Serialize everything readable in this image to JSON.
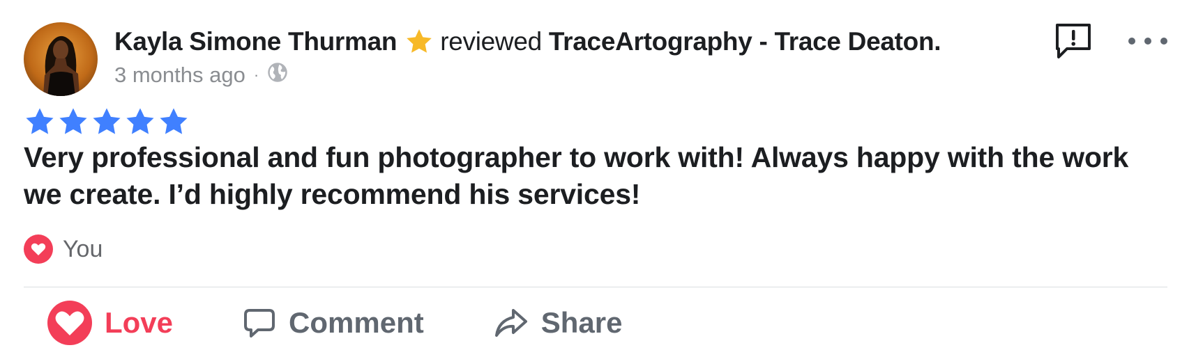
{
  "post": {
    "author_name": "Kayla Simone Thurman",
    "action_text": "reviewed",
    "page_name": "TraceArtography - Trace Deaton.",
    "timestamp": "3 months ago",
    "separator": "·",
    "privacy_icon": "globe-icon",
    "badge_icon": "star-icon",
    "rating": 5,
    "rating_max": 5,
    "review_text": "Very professional and fun photographer to work with! Always happy with the work we create. I’d highly recommend his services!"
  },
  "reactions": {
    "icon": "heart-icon",
    "label": "You"
  },
  "actions": {
    "love_label": "Love",
    "comment_label": "Comment",
    "share_label": "Share"
  },
  "colors": {
    "star_blue": "#4080ff",
    "badge_gold": "#f7b928",
    "love_red": "#f33e58",
    "muted_text": "#8a8d91",
    "action_gray": "#606770",
    "divider": "#dadde1"
  }
}
